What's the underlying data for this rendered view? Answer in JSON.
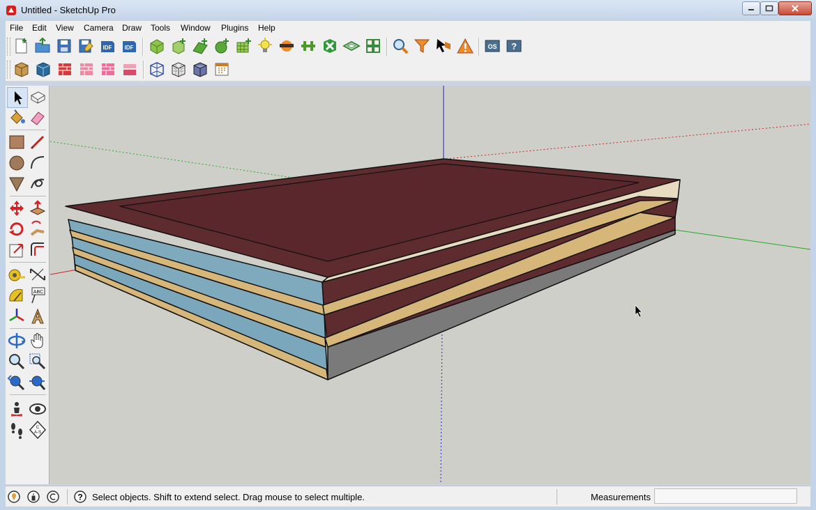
{
  "window": {
    "title": "Untitled - SketchUp Pro"
  },
  "menu": [
    "File",
    "Edit",
    "View",
    "Camera",
    "Draw",
    "Tools",
    "Window",
    "Plugins",
    "Help"
  ],
  "toolbar1": [
    "new-icon",
    "open-icon",
    "save-icon",
    "save-as-icon",
    "import-idf-icon",
    "export-idf-icon",
    "new-zone-icon",
    "new-space-icon",
    "new-surface-icon",
    "add-subsurface-icon",
    "new-grid-icon",
    "light-icon",
    "shading-icon",
    "interzone-icon",
    "render-icon",
    "surface-matching-icon",
    "grid-layout-icon",
    "inspector-icon",
    "filter-icon",
    "select-icon",
    "warning-icon",
    "openstudio-icon",
    "help-icon"
  ],
  "toolbar2": [
    "space-type-icon",
    "construction-icon",
    "boundary-icon",
    "zone-icon",
    "thermal-zone-icon",
    "story-icon",
    "wireframe-icon",
    "hidden-line-icon",
    "shaded-icon",
    "calendar-icon"
  ],
  "status": {
    "text": "Select objects. Shift to extend select. Drag mouse to select multiple.",
    "measurements_label": "Measurements"
  },
  "colors": {
    "roof": "#5e2b2f",
    "floor_edge": "#d7b67a",
    "glass": "#7fa9bd",
    "ground": "#cfcfc9",
    "axis_red": "#cc2222",
    "axis_green": "#22aa22",
    "axis_blue": "#2222cc"
  }
}
